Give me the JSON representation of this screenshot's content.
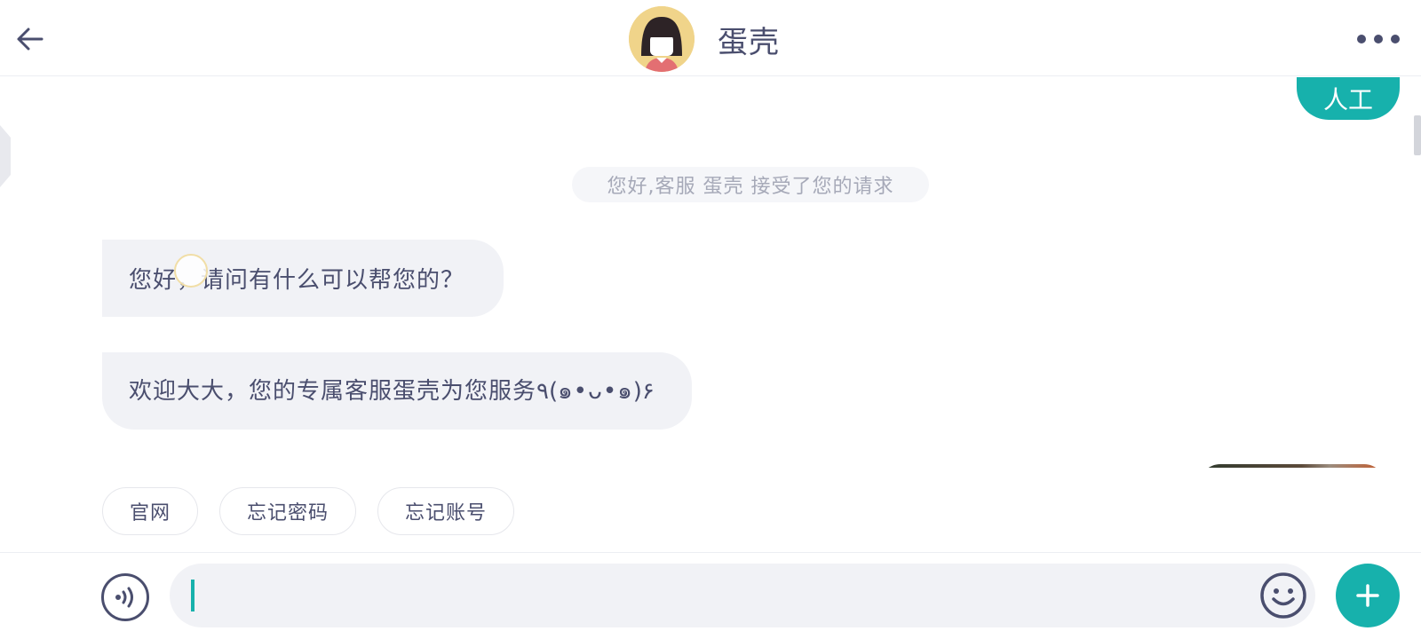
{
  "header": {
    "title": "蛋壳",
    "back_icon": "arrow-left-icon",
    "more_icon": "more-dots-icon",
    "avatar_icon": "agent-avatar"
  },
  "chat": {
    "user_message": "人工",
    "system_note": "您好,客服  蛋壳  接受了您的请求",
    "agent_messages": [
      "您好，请问有什么可以帮您的？",
      "欢迎大大，您的专属客服蛋壳为您服务٩(๑•ᴗ•๑)۶"
    ]
  },
  "quick_replies": [
    "官网",
    "忘记密码",
    "忘记账号"
  ],
  "composer": {
    "input_value": "",
    "input_placeholder": "",
    "voice_icon": "voice-icon",
    "emoji_icon": "emoji-smile-icon",
    "plus_icon": "plus-icon"
  },
  "colors": {
    "accent": "#17b1ac",
    "text": "#4a4e6e",
    "bubble": "#f1f2f6",
    "muted": "#a6a9b8"
  }
}
